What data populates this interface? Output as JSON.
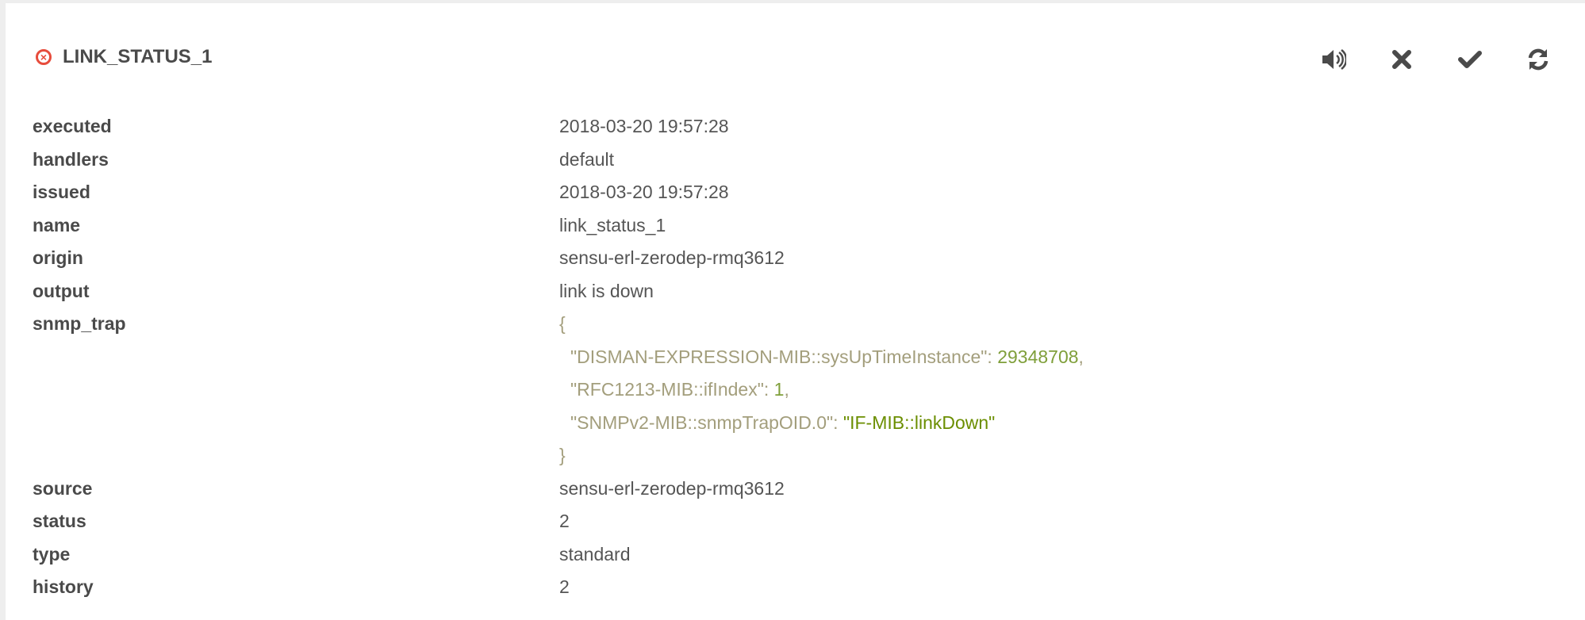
{
  "header": {
    "title": "LINK_STATUS_1",
    "status_icon": "error-circle-icon",
    "status_color": "#e74c3c"
  },
  "actions": [
    {
      "name": "silence",
      "icon": "volume-icon"
    },
    {
      "name": "resolve",
      "icon": "close-icon"
    },
    {
      "name": "acknowledge",
      "icon": "check-icon"
    },
    {
      "name": "refresh",
      "icon": "refresh-icon"
    }
  ],
  "fields": {
    "executed": {
      "label": "executed",
      "value": "2018-03-20 19:57:28"
    },
    "handlers": {
      "label": "handlers",
      "value": "default"
    },
    "issued": {
      "label": "issued",
      "value": "2018-03-20 19:57:28"
    },
    "name": {
      "label": "name",
      "value": "link_status_1"
    },
    "origin": {
      "label": "origin",
      "value": "sensu-erl-zerodep-rmq3612"
    },
    "output": {
      "label": "output",
      "value": "link is down"
    },
    "snmp_trap": {
      "label": "snmp_trap",
      "open": "{",
      "close": "}",
      "entries": [
        {
          "key": "\"DISMAN-EXPRESSION-MIB::sysUpTimeInstance\"",
          "value": "29348708",
          "sep": ","
        },
        {
          "key": "\"RFC1213-MIB::ifIndex\"",
          "value": "1",
          "sep": ","
        },
        {
          "key": "\"SNMPv2-MIB::snmpTrapOID.0\"",
          "value": "\"IF-MIB::linkDown\"",
          "sep": ""
        }
      ]
    },
    "source": {
      "label": "source",
      "value": "sensu-erl-zerodep-rmq3612"
    },
    "status": {
      "label": "status",
      "value": "2"
    },
    "type": {
      "label": "type",
      "value": "standard"
    },
    "history": {
      "label": "history",
      "value": "2"
    }
  }
}
